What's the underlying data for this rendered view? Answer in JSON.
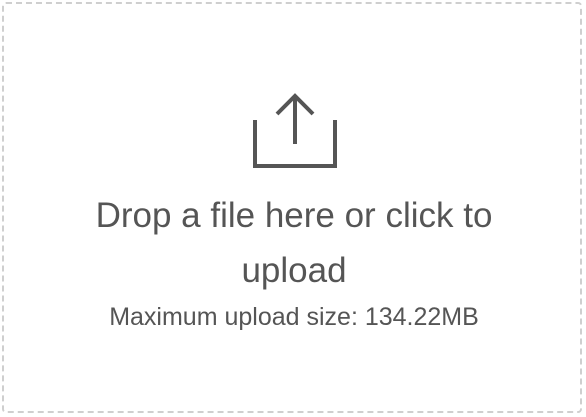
{
  "dropzone": {
    "prompt": "Drop a file here or click to upload",
    "limit_text": "Maximum upload size: 134.22MB",
    "icon": "upload-icon"
  },
  "colors": {
    "text": "#555555",
    "border": "#cfcfcf",
    "icon": "#555555"
  }
}
